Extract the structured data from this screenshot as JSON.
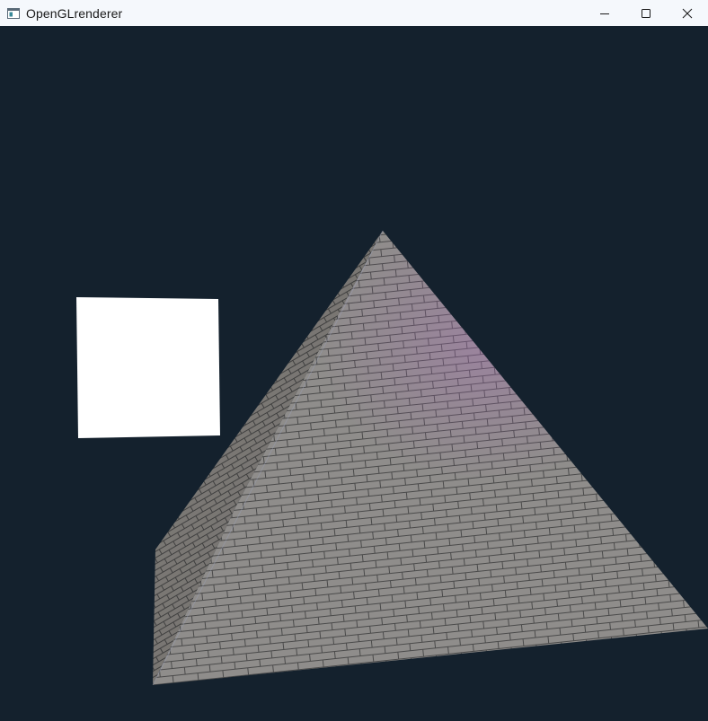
{
  "window": {
    "title": "OpenGLrenderer",
    "icon": "app-window-icon"
  },
  "controls": {
    "minimize_icon": "minimize-icon",
    "maximize_icon": "maximize-icon",
    "close_icon": "close-icon"
  },
  "scene": {
    "clear_color": "#14212d",
    "light_cube_color": "#ffffff",
    "pyramid_texture": "brick",
    "pyramid_tint": "#8f8c8a"
  }
}
